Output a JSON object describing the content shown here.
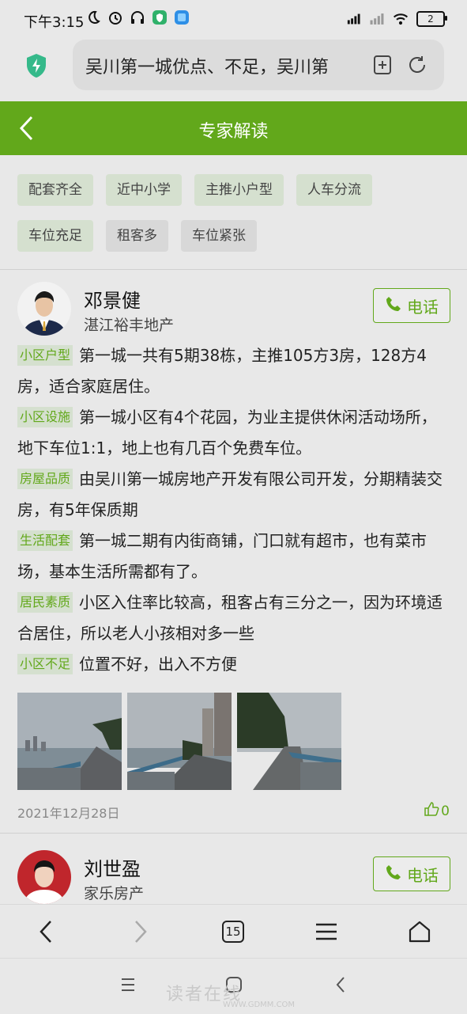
{
  "status": {
    "time": "下午3:15",
    "battery": "2"
  },
  "browser": {
    "url_text": "吴川第一城优点、不足，吴川第"
  },
  "header": {
    "title": "专家解读"
  },
  "tags": [
    {
      "label": "配套齐全"
    },
    {
      "label": "近中小学"
    },
    {
      "label": "主推小户型"
    },
    {
      "label": "人车分流"
    },
    {
      "label": "车位充足"
    },
    {
      "label": "租客多"
    },
    {
      "label": "车位紧张"
    }
  ],
  "experts": [
    {
      "name": "邓景健",
      "company": "湛江裕丰地产",
      "call_label": "电话",
      "reviews": [
        {
          "label": "小区户型",
          "text": "第一城一共有5期38栋，主推105方3房，128方4房，适合家庭居住。"
        },
        {
          "label": "小区设施",
          "text": "第一城小区有4个花园，为业主提供休闲活动场所，地下车位1:1，地上也有几百个免费车位。"
        },
        {
          "label": "房屋品质",
          "text": "由吴川第一城房地产开发有限公司开发，分期精装交房，有5年保质期"
        },
        {
          "label": "生活配套",
          "text": "第一城二期有内街商铺，门口就有超市，也有菜市场，基本生活所需都有了。"
        },
        {
          "label": "居民素质",
          "text": "小区入住率比较高，租客占有三分之一，因为环境适合居住，所以老人小孩相对多一些"
        },
        {
          "label": "小区不足",
          "text": "位置不好，出入不方便"
        }
      ],
      "date": "2021年12月28日",
      "likes": "0"
    },
    {
      "name": "刘世盈",
      "company": "家乐房产",
      "call_label": "电话"
    }
  ],
  "bottom_nav": {
    "tabs_count": "15"
  },
  "watermark": {
    "text": "读者在线",
    "sub": "WWW.GDMM.COM"
  },
  "colors": {
    "accent": "#62a81b",
    "tag_bg": "#d5e0cf"
  }
}
